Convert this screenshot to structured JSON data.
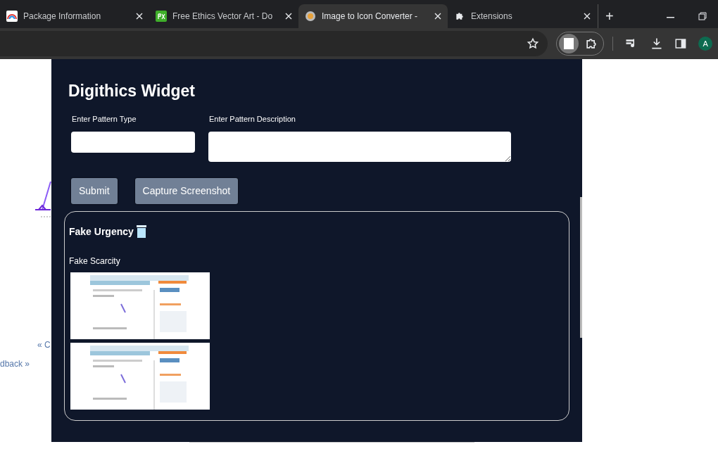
{
  "browser": {
    "tabs": [
      {
        "title": "Package Information",
        "selected": false
      },
      {
        "title": "Free Ethics Vector Art - Do",
        "selected": false
      },
      {
        "title": "Image to Icon Converter -",
        "selected": true
      },
      {
        "title": "Extensions",
        "selected": false
      }
    ],
    "new_tab": "+",
    "profile": "A"
  },
  "page": {
    "links": [
      "« C",
      "dback »"
    ]
  },
  "widget": {
    "title": "Digithics Widget",
    "fields": [
      {
        "label": "Enter Pattern Type",
        "kind": "input"
      },
      {
        "label": "Enter Pattern Description",
        "kind": "textarea"
      }
    ],
    "buttons": [
      "Submit",
      "Capture Screenshot"
    ],
    "card": {
      "title": "Fake Urgency",
      "subtitle": "Fake Scarcity"
    }
  }
}
